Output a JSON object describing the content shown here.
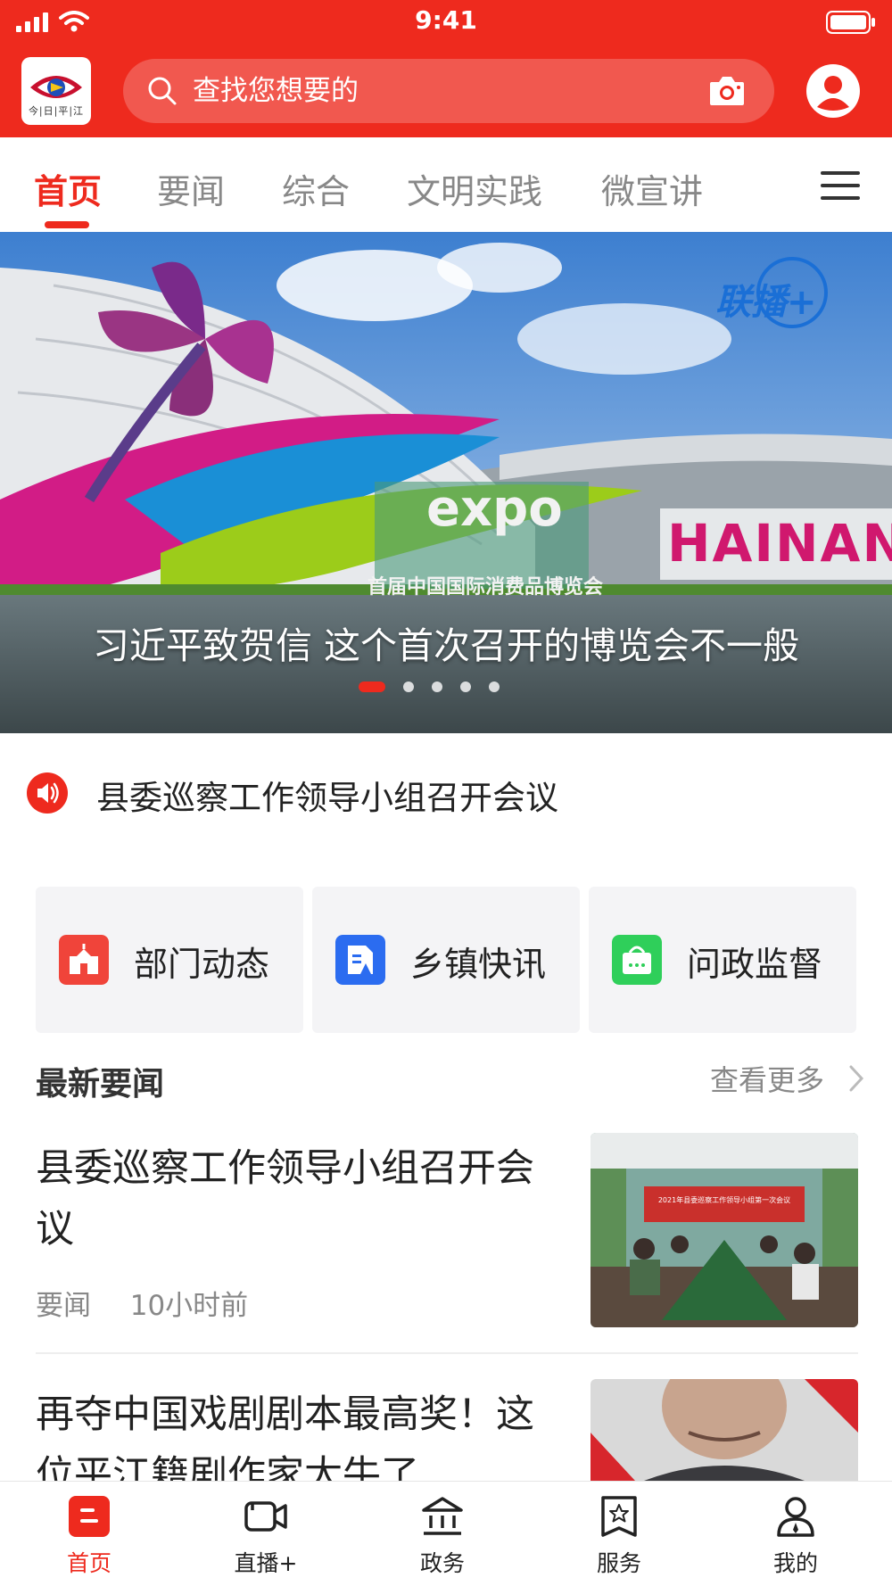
{
  "status_bar": {
    "time": "9:41"
  },
  "header": {
    "logo_text": "今|日|平|江",
    "search_placeholder": "查找您想要的",
    "brand_color": "#ee2a1e"
  },
  "tabs": [
    {
      "label": "首页",
      "active": true
    },
    {
      "label": "要闻",
      "active": false
    },
    {
      "label": "综合",
      "active": false
    },
    {
      "label": "文明实践",
      "active": false
    },
    {
      "label": "微宣讲",
      "active": false
    }
  ],
  "banner": {
    "caption": "习近平致贺信 这个首次召开的博览会不一般",
    "logo_text": "联播+",
    "sign_text": "expo",
    "building_text": "HAINAN",
    "sign_subtitle": "首届中国国际消费品博览会",
    "slide_count": 5,
    "active_slide": 1
  },
  "announcement": {
    "text": "县委巡察工作领导小组召开会议"
  },
  "quick_entries": [
    {
      "label": "部门动态",
      "icon": "building-icon",
      "color": "#f0443a"
    },
    {
      "label": "乡镇快讯",
      "icon": "document-icon",
      "color": "#2b6cf0"
    },
    {
      "label": "问政监督",
      "icon": "mailbox-icon",
      "color": "#2fcf5a"
    }
  ],
  "latest_news": {
    "title": "最新要闻",
    "more_label": "查看更多",
    "items": [
      {
        "title": "县委巡察工作领导小组召开会议",
        "category": "要闻",
        "time": "10小时前",
        "thumb_banner_text": "2021年县委巡察工作领导小组第一次会议"
      },
      {
        "title": "再夺中国戏剧剧本最高奖！这位平江籍剧作家太牛了"
      }
    ]
  },
  "bottom_nav": [
    {
      "label": "首页",
      "icon": "home-icon",
      "active": true
    },
    {
      "label": "直播+",
      "icon": "video-camera-icon",
      "active": false
    },
    {
      "label": "政务",
      "icon": "government-building-icon",
      "active": false
    },
    {
      "label": "服务",
      "icon": "service-star-icon",
      "active": false
    },
    {
      "label": "我的",
      "icon": "profile-icon",
      "active": false
    }
  ]
}
